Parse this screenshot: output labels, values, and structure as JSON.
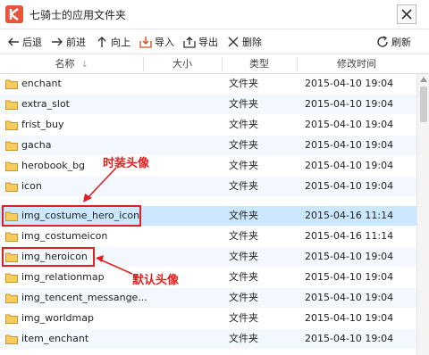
{
  "window": {
    "title": "七骑士的应用文件夹"
  },
  "toolbar": {
    "back": "后退",
    "forward": "前进",
    "up": "向上",
    "import": "导入",
    "export": "导出",
    "delete": "删除",
    "refresh": "刷新"
  },
  "columns": {
    "name": "名称",
    "size": "大小",
    "type": "类型",
    "modified": "修改时间"
  },
  "rows": [
    {
      "name": "enchant",
      "type": "文件夹",
      "date": "2015-04-10 19:04"
    },
    {
      "name": "extra_slot",
      "type": "文件夹",
      "date": "2015-04-10 19:04"
    },
    {
      "name": "frist_buy",
      "type": "文件夹",
      "date": "2015-04-10 19:04"
    },
    {
      "name": "gacha",
      "type": "文件夹",
      "date": "2015-04-10 19:04"
    },
    {
      "name": "herobook_bg",
      "type": "文件夹",
      "date": "2015-04-10 19:04"
    },
    {
      "name": "icon",
      "type": "文件夹",
      "date": "2015-04-10 19:04"
    },
    {
      "name": "img_costume_hero_icon",
      "type": "文件夹",
      "date": "2015-04-16 11:14"
    },
    {
      "name": "img_costumeicon",
      "type": "文件夹",
      "date": "2015-04-16 11:14"
    },
    {
      "name": "img_heroicon",
      "type": "文件夹",
      "date": "2015-04-10 19:04"
    },
    {
      "name": "img_relationmap",
      "type": "文件夹",
      "date": "2015-04-10 19:04"
    },
    {
      "name": "img_tencent_messange...",
      "type": "文件夹",
      "date": "2015-04-10 19:04"
    },
    {
      "name": "img_worldmap",
      "type": "文件夹",
      "date": "2015-04-10 19:04"
    },
    {
      "name": "item_enchant",
      "type": "文件夹",
      "date": "2015-04-10 19:04"
    }
  ],
  "annotations": {
    "costume": "时装头像",
    "default": "默认头像"
  },
  "colors": {
    "accent": "#e02020",
    "selected": "#cce8ff",
    "folder": "#e8b84a"
  }
}
